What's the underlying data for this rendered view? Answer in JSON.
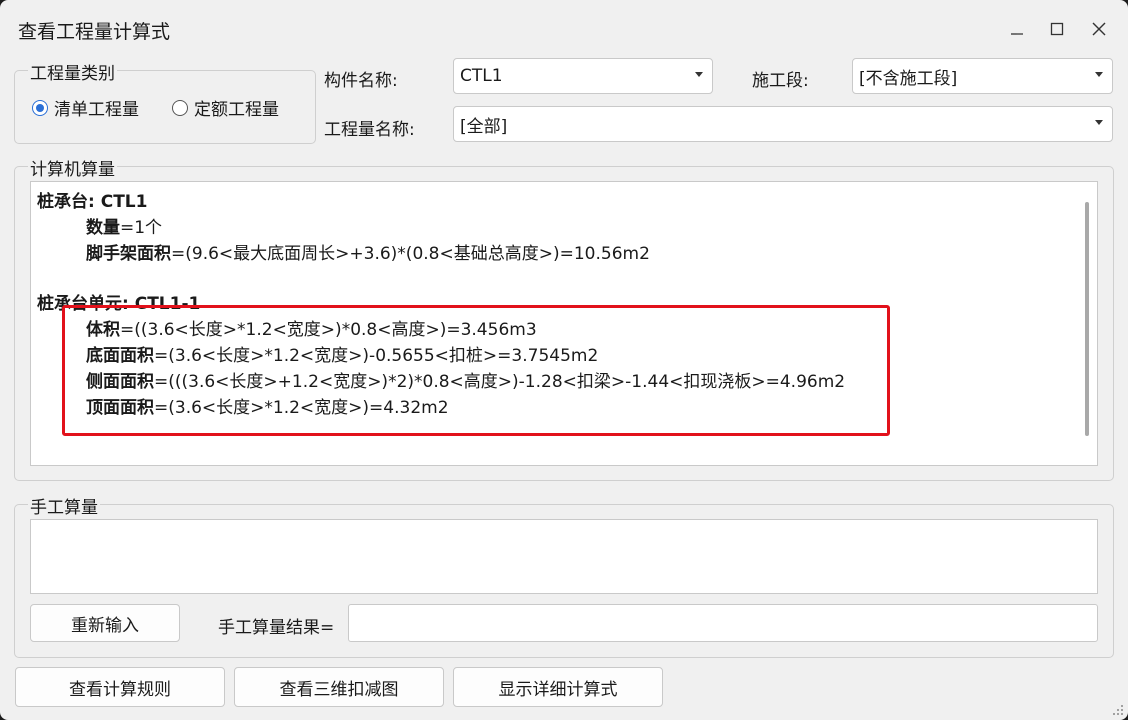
{
  "window": {
    "title": "查看工程量计算式"
  },
  "qty_category": {
    "label": "工程量类别",
    "options": [
      {
        "label": "清单工程量",
        "selected": true
      },
      {
        "label": "定额工程量",
        "selected": false
      }
    ]
  },
  "component": {
    "label": "构件名称:",
    "value": "CTL1"
  },
  "stage": {
    "label": "施工段:",
    "value": "[不含施工段]"
  },
  "qty_name": {
    "label": "工程量名称:",
    "value": "[全部]"
  },
  "computer": {
    "label": "计算机算量",
    "lines": [
      {
        "b": "桩承台: CTL1",
        "t": ""
      },
      {
        "b": "数量",
        "t": "=1个"
      },
      {
        "b": "脚手架面积",
        "t": "=(9.6<最大底面周长>+3.6)*(0.8<基础总高度>)=10.56m2"
      },
      {
        "b": "桩承台单元: CTL1-1",
        "t": ""
      },
      {
        "b": "体积",
        "t": "=((3.6<长度>*1.2<宽度>)*0.8<高度>)=3.456m3"
      },
      {
        "b": "底面面积",
        "t": "=(3.6<长度>*1.2<宽度>)-0.5655<扣桩>=3.7545m2"
      },
      {
        "b": "侧面面积",
        "t": "=(((3.6<长度>+1.2<宽度>)*2)*0.8<高度>)-1.28<扣梁>-1.44<扣现浇板>=4.96m2"
      },
      {
        "b": "顶面面积",
        "t": "=(3.6<长度>*1.2<宽度>)=4.32m2"
      }
    ]
  },
  "manual": {
    "label": "手工算量",
    "reenter_button": "重新输入",
    "result_label": "手工算量结果="
  },
  "footer": {
    "rules_button": "查看计算规则",
    "3d_button": "查看三维扣减图",
    "detail_button": "显示详细计算式"
  },
  "colors": {
    "highlight_box": "#e2111b",
    "radio_accent": "#2a6fd6"
  }
}
